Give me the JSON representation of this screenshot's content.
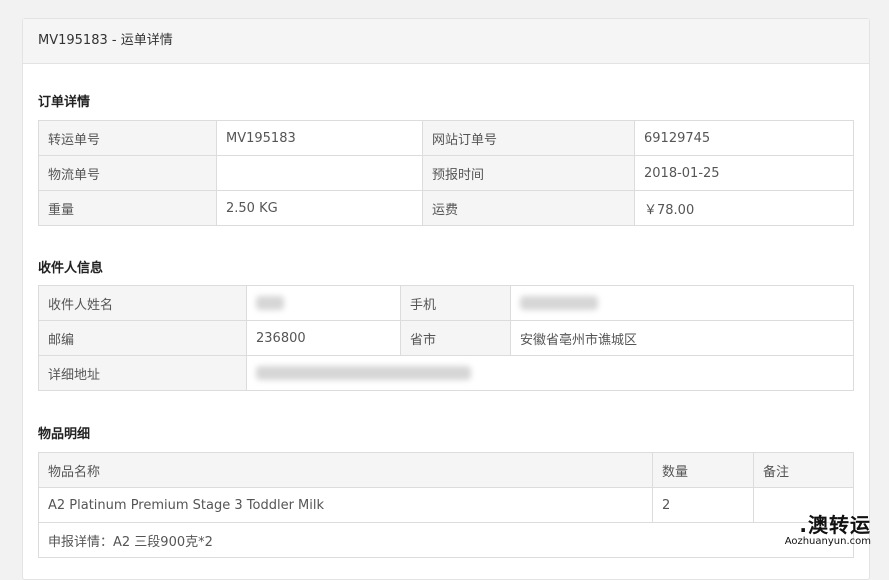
{
  "header": {
    "title": "MV195183 - 运单详情"
  },
  "order_section": {
    "title": "订单详情",
    "rows": [
      {
        "l1": "转运单号",
        "v1": "MV195183",
        "l2": "网站订单号",
        "v2": "69129745"
      },
      {
        "l1": "物流单号",
        "v1": "",
        "l2": "预报时间",
        "v2": "2018-01-25"
      },
      {
        "l1": "重量",
        "v1": "2.50 KG",
        "l2": "运费",
        "v2": "￥78.00"
      }
    ]
  },
  "recipient_section": {
    "title": "收件人信息",
    "name_label": "收件人姓名",
    "phone_label": "手机",
    "zip_label": "邮编",
    "zip_value": "236800",
    "province_label": "省市",
    "province_value": "安徽省亳州市谯城区",
    "address_label": "详细地址"
  },
  "items_section": {
    "title": "物品明细",
    "headers": {
      "name": "物品名称",
      "qty": "数量",
      "note": "备注"
    },
    "item": {
      "name": "A2 Platinum Premium Stage 3 Toddler Milk",
      "qty": "2",
      "note": ""
    },
    "declare": "申报详情：A2 三段900克*2"
  },
  "watermark": {
    "main": ".澳转运",
    "sub": "Aozhuanyun.com"
  }
}
